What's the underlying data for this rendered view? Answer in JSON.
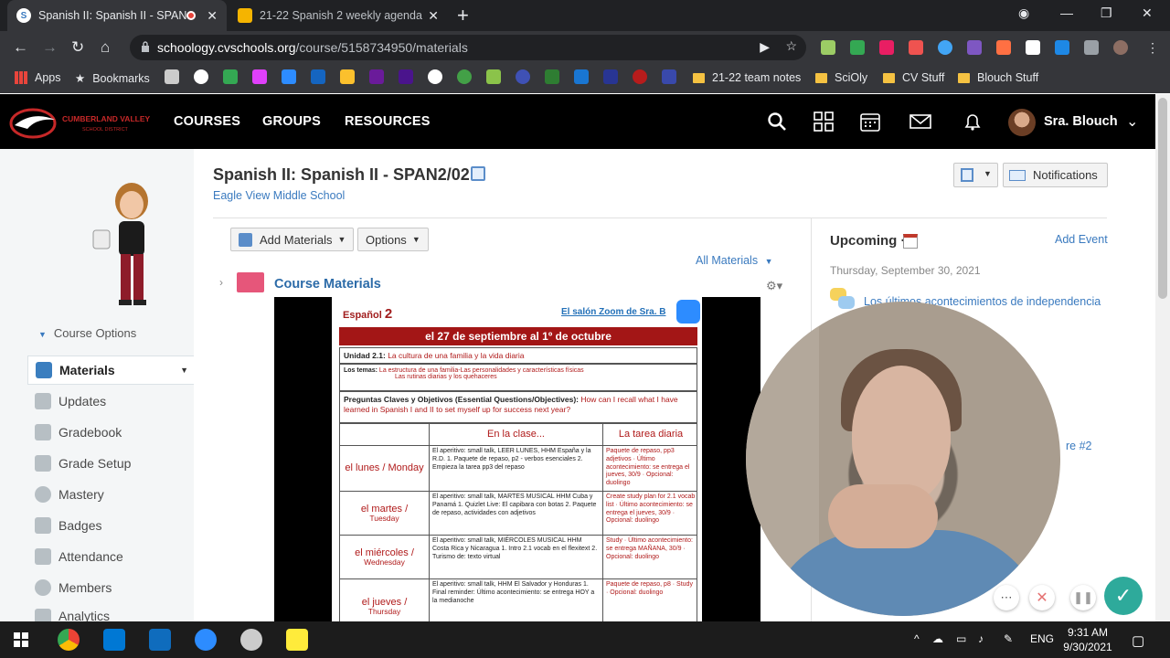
{
  "browser": {
    "tabs": [
      {
        "title": "Spanish II: Spanish II - SPAN",
        "active": true
      },
      {
        "title": "21-22 Spanish 2 weekly agenda (",
        "active": false
      }
    ],
    "url_host": "schoology.cvschools.org",
    "url_path": "/course/5158734950/materials",
    "bookmarks": {
      "apps": "Apps",
      "bookmarks": "Bookmarks",
      "folders": [
        "21-22 team notes",
        "SciOly",
        "CV Stuff",
        "Blouch Stuff"
      ]
    }
  },
  "header": {
    "nav": [
      "COURSES",
      "GROUPS",
      "RESOURCES"
    ],
    "user_name": "Sra. Blouch",
    "logo_text": "CUMBERLAND VALLEY SCHOOL DISTRICT"
  },
  "sidebar": {
    "course_options": "Course Options",
    "items": [
      {
        "label": "Materials"
      },
      {
        "label": "Updates"
      },
      {
        "label": "Gradebook"
      },
      {
        "label": "Grade Setup"
      },
      {
        "label": "Mastery"
      },
      {
        "label": "Badges"
      },
      {
        "label": "Attendance"
      },
      {
        "label": "Members"
      },
      {
        "label": "Analytics"
      }
    ]
  },
  "course": {
    "title": "Spanish II: Spanish II - SPAN2/02",
    "school": "Eagle View Middle School",
    "add_materials": "Add Materials",
    "options": "Options",
    "all_materials": "All Materials",
    "folder": "Course Materials",
    "notifications": "Notifications"
  },
  "agenda": {
    "heading_word": "Español",
    "heading_num": "2",
    "zoom_link": "El salón Zoom de Sra. B",
    "week": "el 27 de septiembre al 1º de octubre",
    "unit_label": "Unidad 2.1:",
    "unit_title": "La cultura de una familia y la vida diaria",
    "topics_label": "Los temas:",
    "topics_1": "La estructura de una familia-Las personalidades y características físicas",
    "topics_2": "Las rutinas diarias y los quehaceres",
    "eq_label": "Preguntas Claves y Objetivos (Essential Questions/Objectives):",
    "eq_text": "How can I recall what I have learned in Spanish I and II to set myself up for success next year?",
    "col_class": "En la clase...",
    "col_hw": "La tarea diaria",
    "days": [
      {
        "day": "el lunes / Monday",
        "sub": "",
        "class": "El aperitivo: small talk, LEER LUNES, HHM España y la R.D. 1. Paquete de repaso, p2 - verbos esenciales 2. Empieza la tarea pp3 del repaso",
        "hw": "Paquete de repaso, pp3 adjetivos · Último acontecimiento: se entrega el jueves, 30/9 · Opcional: duolingo"
      },
      {
        "day": "el martes /",
        "sub": "Tuesday",
        "class": "El aperitivo: small talk, MARTES MUSICAL HHM Cuba y Panamá 1. Quizlet Live: El capibara con botas 2. Paquete de repaso, actividades con adjetivos",
        "hw": "Create study plan for 2.1 vocab list · Último acontecimiento: se entrega el jueves, 30/9 · Opcional: duolingo"
      },
      {
        "day": "el miércoles /",
        "sub": "Wednesday",
        "class": "El aperitivo: small talk, MIÉRCOLES MUSICAL HHM Costa Rica y Nicaragua 1. Intro 2.1 vocab en el flexitext 2. Turismo de: texto virtual",
        "hw": "Study · Último acontecimiento: se entrega MAÑANA, 30/9 · Opcional: duolingo"
      },
      {
        "day": "el jueves /",
        "sub": "Thursday",
        "class": "El aperitivo: small talk, HHM El Salvador y Honduras 1. Final reminder: Último acontecimiento: se entrega HOY a la medianoche",
        "hw": "Paquete de repaso, p8 · Study · Opcional: duolingo"
      }
    ]
  },
  "upcoming": {
    "title": "Upcoming",
    "add_event": "Add Event",
    "date": "Thursday, September 30, 2021",
    "event": "Los últimos acontecimientos de independencia",
    "partial": "re #2"
  },
  "taskbar": {
    "lang": "ENG",
    "time": "9:31 AM",
    "date": "9/30/2021"
  }
}
